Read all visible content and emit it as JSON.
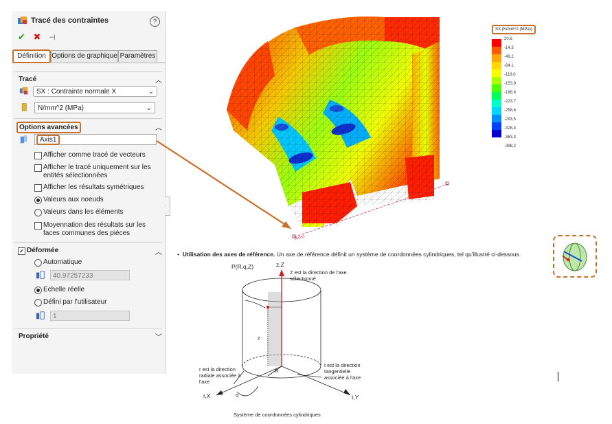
{
  "panel": {
    "title": "Tracé des contraintes",
    "help": "?",
    "tabs": [
      "Définition",
      "Options de graphique",
      "Paramètres"
    ],
    "trace": {
      "header": "Tracé",
      "component": "SX : Contrainte normale X",
      "units": "N/mm^2 (MPa)"
    },
    "advanced": {
      "header": "Options avancées",
      "axis": "Axis1",
      "options": [
        {
          "label": "Afficher comme tracé de vecteurs",
          "type": "checkbox",
          "checked": false
        },
        {
          "label": "Afficher le tracé uniquement sur les entités sélectionnées",
          "type": "checkbox",
          "checked": false
        },
        {
          "label": "Afficher les résultats symétriques",
          "type": "checkbox",
          "checked": false
        },
        {
          "label": "Valeurs aux noeuds",
          "type": "radio",
          "checked": true
        },
        {
          "label": "Valeurs dans les éléments",
          "type": "radio",
          "checked": false
        },
        {
          "label": "Moyennation des résultats sur les faces communes des pièces",
          "type": "checkbox",
          "checked": false
        }
      ]
    },
    "deformed": {
      "header": "Déformée",
      "checked": true,
      "auto_label": "Automatique",
      "auto_value": "40.97257233",
      "real_label": "Echelle réelle",
      "user_label": "Défini par l'utilisateur",
      "user_value": "1"
    },
    "property": {
      "header": "Propriété"
    }
  },
  "legend": {
    "title": "SX (N/mm^2 (MPa))",
    "values": [
      "20.6",
      "-14.3",
      "-49.2",
      "-84.1",
      "-119,0",
      "-153,9",
      "-188,8",
      "-223,7",
      "-258,6",
      "-293,5",
      "-328,4",
      "-363,3",
      "-398,2"
    ],
    "colors": [
      "#ff0000",
      "#ff5a00",
      "#ffa500",
      "#ffd800",
      "#f4ff00",
      "#aaff00",
      "#4dff00",
      "#00ff5a",
      "#00ffc8",
      "#00d8ff",
      "#0090ff",
      "#0040ff",
      "#0000d0"
    ]
  },
  "model": {
    "axis_label": "Axis1"
  },
  "caption": {
    "bold": "Utilisation des axes de référence.",
    "text": " Un axe de référence définit un système de coordonnées cylindriques, tel qu'illustré ci-dessous."
  },
  "diagram": {
    "point": "P(R,q,Z)",
    "z_axis": "z,Z",
    "z_desc": "Z est la direction de l'axe sélectionné",
    "z_small": "z",
    "R": "R",
    "r_desc": "r est la direction radiale associée à l'axe",
    "t_desc": "t est la direction tangentielle associée à l'axe",
    "r_axis": "r,X",
    "t_axis": "t,Y",
    "q": "q",
    "title": "Système de coordonnées cylindriques"
  }
}
